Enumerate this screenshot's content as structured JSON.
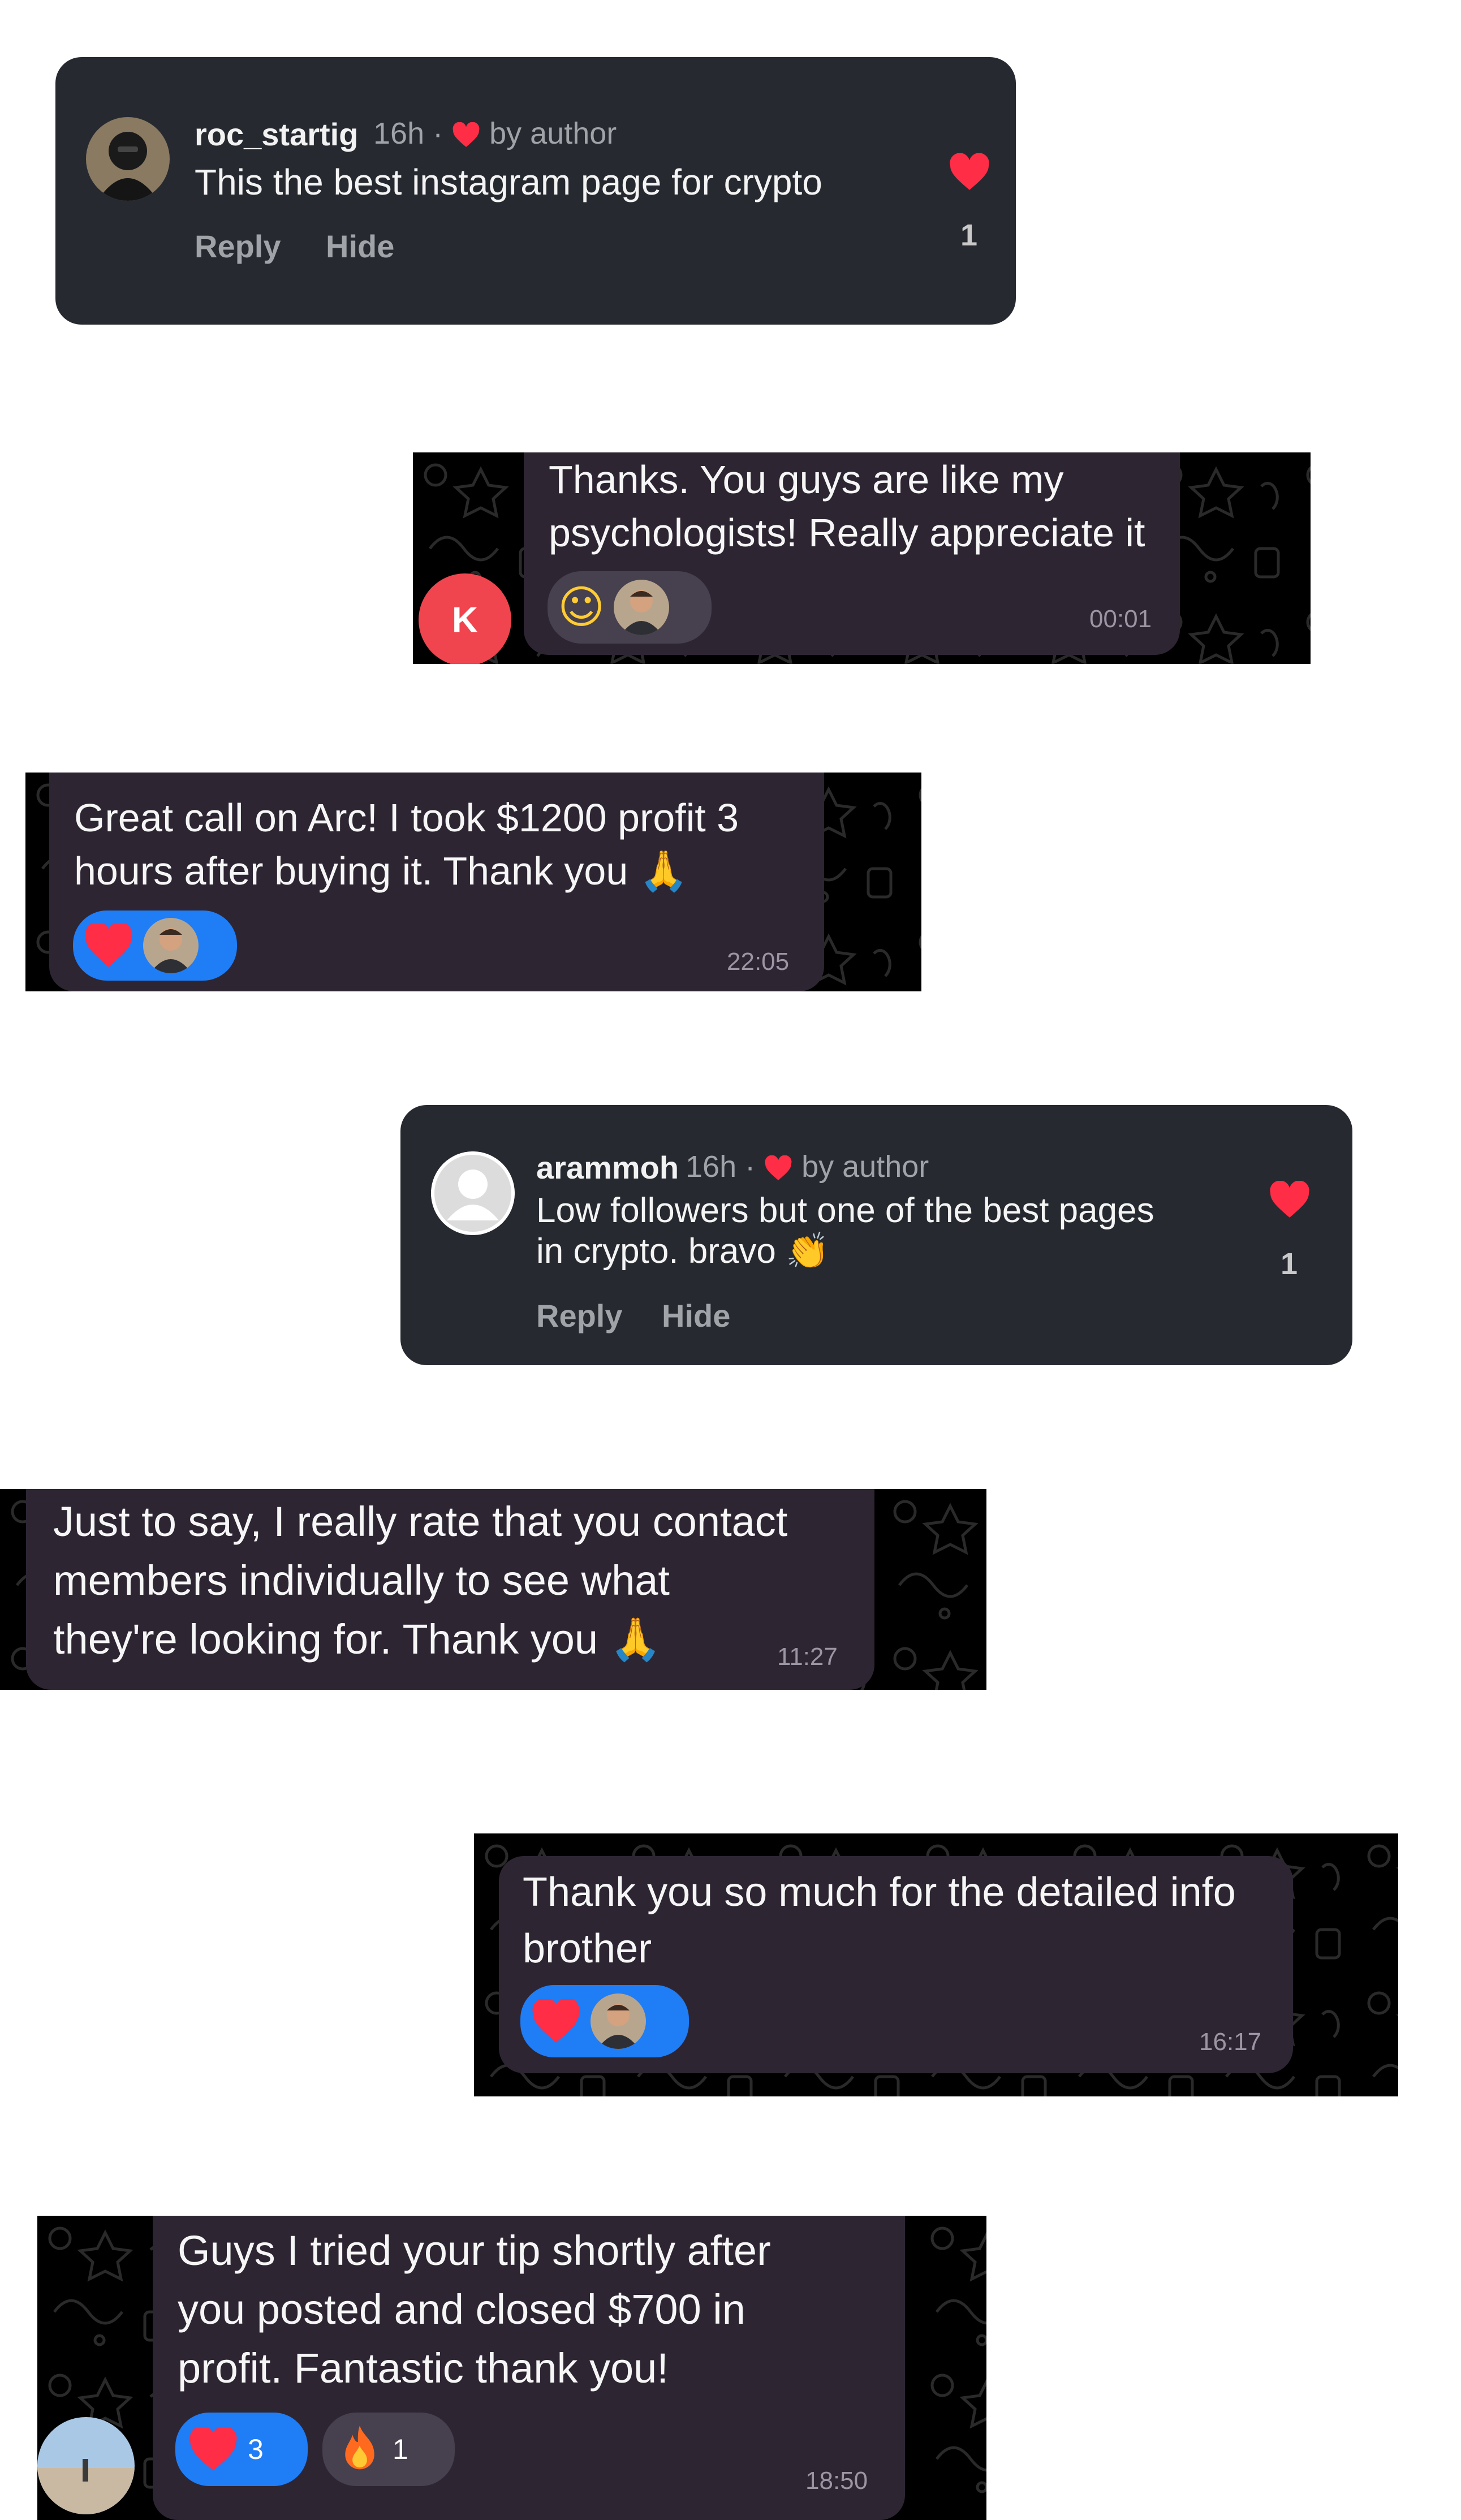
{
  "comments": [
    {
      "username": "roc_startig",
      "time": "16h",
      "author_badge": "by author",
      "text": "This the best instagram page for crypto",
      "actions": [
        "Reply",
        "Hide"
      ],
      "like_count": "1"
    },
    {
      "username": "arammoh",
      "time": "16h",
      "author_badge": "by author",
      "text_lines": [
        "Low followers but one of the best pages",
        "in crypto. bravo 👏"
      ],
      "actions": [
        "Reply",
        "Hide"
      ],
      "like_count": "1"
    }
  ],
  "messages": [
    {
      "lines": [
        "Thanks. You guys are like my",
        "psychologists! Really appreciate it"
      ],
      "time": "00:01",
      "sender_initial": "K",
      "reactions": [
        "rofl-emoji",
        "user-avatar"
      ]
    },
    {
      "lines": [
        "Great call on Arc! I took $1200 profit 3",
        "hours after buying it. Thank you 🙏"
      ],
      "time": "22:05",
      "reactions": [
        "heart",
        "user-avatar"
      ]
    },
    {
      "lines": [
        "Just to say, I really rate that you contact",
        "members individually to see what",
        "they're looking for. Thank you 🙏"
      ],
      "time": "11:27"
    },
    {
      "lines": [
        "Thank you so much for the detailed info",
        "brother"
      ],
      "time": "16:17",
      "reactions": [
        "heart",
        "user-avatar"
      ]
    },
    {
      "lines": [
        "Guys I tried your tip shortly after",
        "you posted and closed $700 in",
        "profit. Fantastic thank you!"
      ],
      "time": "18:50",
      "reactions": [
        {
          "icon": "heart",
          "count": "3"
        },
        {
          "icon": "fire",
          "count": "1"
        }
      ]
    }
  ],
  "colors": {
    "card_bg": "#262a30",
    "bubble_bg": "#2e2533",
    "heart_red": "#ff2d46",
    "reaction_blue": "#1f7df5",
    "initial_avatar": "#f0444f"
  }
}
